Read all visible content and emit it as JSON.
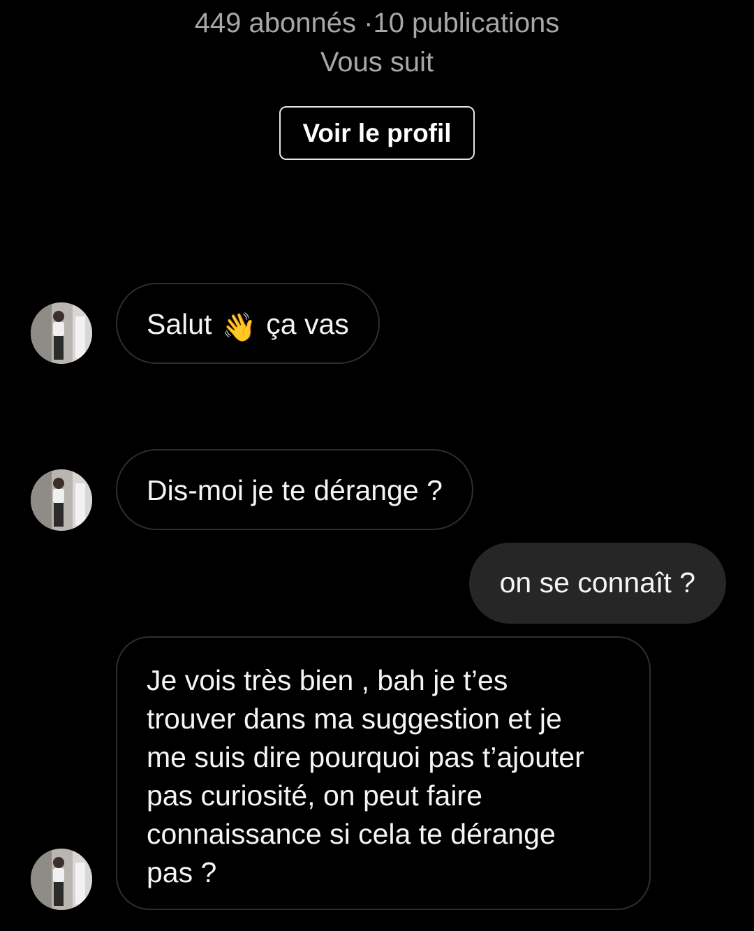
{
  "profile": {
    "stats": "449 abonnés ·10 publications",
    "follow_status": "Vous suit",
    "view_profile_label": "Voir le profil"
  },
  "messages": [
    {
      "direction": "incoming",
      "text_before": "Salut",
      "icon": "waving-hand-icon",
      "emoji": "👋",
      "text_after": "ça vas"
    },
    {
      "direction": "incoming",
      "text": "Dis-moi je te dérange ?"
    },
    {
      "direction": "outgoing",
      "text": "on se connaît ?"
    },
    {
      "direction": "incoming",
      "lines": [
        "Je vois très bien , bah je t’es",
        "trouver dans ma suggestion et je",
        "me suis dire pourquoi pas t’ajouter",
        "pas curiosité, on peut faire",
        "connaissance si cela te dérange",
        "pas ?"
      ]
    }
  ],
  "colors": {
    "background": "#000000",
    "incoming_bubble_border": "#2e2e2e",
    "outgoing_bubble": "#262626",
    "secondary_text": "#a8a8a8"
  }
}
